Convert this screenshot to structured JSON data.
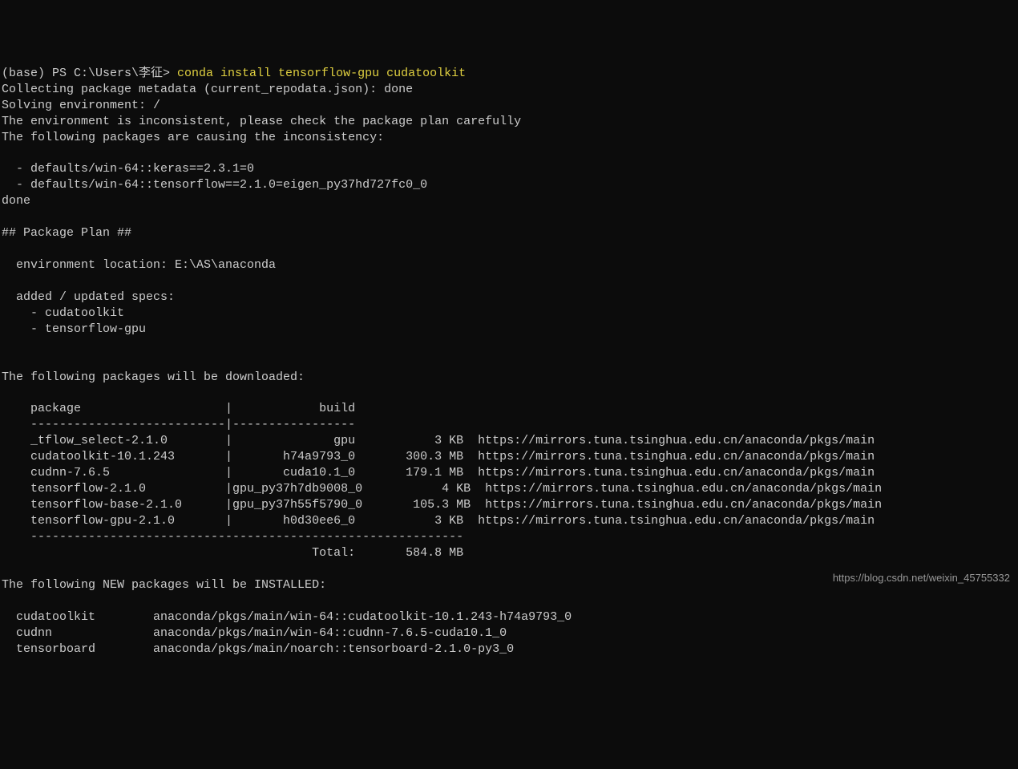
{
  "prompt": {
    "prefix": "(base) PS C:\\Users\\李征> ",
    "command": "conda install tensorflow-gpu cudatoolkit"
  },
  "output": {
    "line01": "Collecting package metadata (current_repodata.json): done",
    "line02": "Solving environment: /",
    "line03": "The environment is inconsistent, please check the package plan carefully",
    "line04": "The following packages are causing the inconsistency:",
    "line05": "",
    "line06": "  - defaults/win-64::keras==2.3.1=0",
    "line07": "  - defaults/win-64::tensorflow==2.1.0=eigen_py37hd727fc0_0",
    "line08": "done",
    "line09": "",
    "line10": "## Package Plan ##",
    "line11": "",
    "line12": "  environment location: E:\\AS\\anaconda",
    "line13": "",
    "line14": "  added / updated specs:",
    "line15": "    - cudatoolkit",
    "line16": "    - tensorflow-gpu",
    "line17": "",
    "line18": "",
    "line19": "The following packages will be downloaded:",
    "line20": "",
    "line21": "    package                    |            build",
    "line22": "    ---------------------------|-----------------",
    "line23": "    _tflow_select-2.1.0        |              gpu           3 KB  https://mirrors.tuna.tsinghua.edu.cn/anaconda/pkgs/main",
    "line24": "    cudatoolkit-10.1.243       |       h74a9793_0       300.3 MB  https://mirrors.tuna.tsinghua.edu.cn/anaconda/pkgs/main",
    "line25": "    cudnn-7.6.5                |       cuda10.1_0       179.1 MB  https://mirrors.tuna.tsinghua.edu.cn/anaconda/pkgs/main",
    "line26": "    tensorflow-2.1.0           |gpu_py37h7db9008_0           4 KB  https://mirrors.tuna.tsinghua.edu.cn/anaconda/pkgs/main",
    "line27": "    tensorflow-base-2.1.0      |gpu_py37h55f5790_0       105.3 MB  https://mirrors.tuna.tsinghua.edu.cn/anaconda/pkgs/main",
    "line28": "    tensorflow-gpu-2.1.0       |       h0d30ee6_0           3 KB  https://mirrors.tuna.tsinghua.edu.cn/anaconda/pkgs/main",
    "line29": "    ------------------------------------------------------------",
    "line30": "                                           Total:       584.8 MB",
    "line31": "",
    "line32": "The following NEW packages will be INSTALLED:",
    "line33": "",
    "line34": "  cudatoolkit        anaconda/pkgs/main/win-64::cudatoolkit-10.1.243-h74a9793_0",
    "line35": "  cudnn              anaconda/pkgs/main/win-64::cudnn-7.6.5-cuda10.1_0",
    "line36": "  tensorboard        anaconda/pkgs/main/noarch::tensorboard-2.1.0-py3_0"
  },
  "watermark": "https://blog.csdn.net/weixin_45755332"
}
